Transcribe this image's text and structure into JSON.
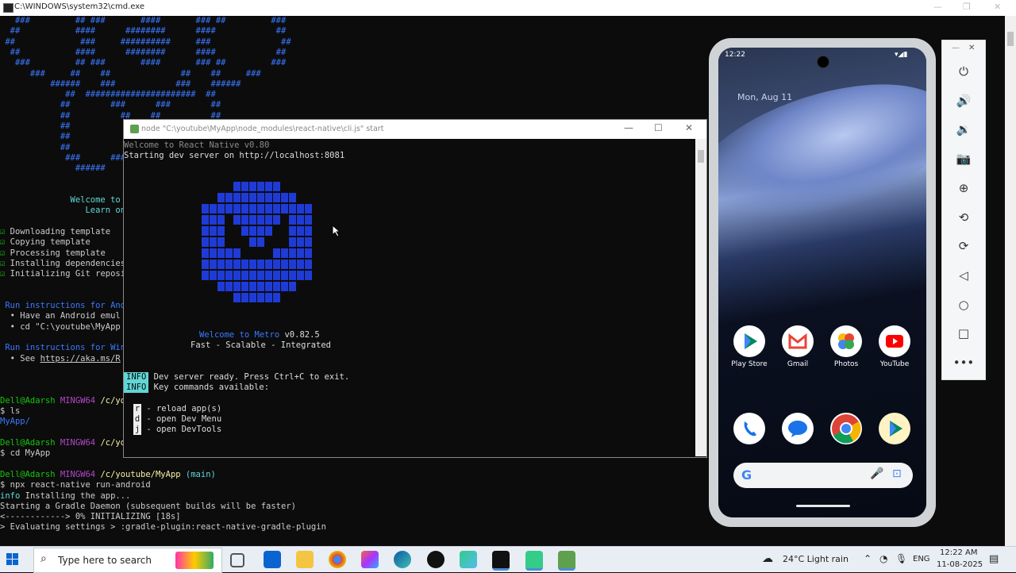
{
  "cmd": {
    "title": "C:\\WINDOWS\\system32\\cmd.exe",
    "ascii_art": [
      "   ###         ## ###       ####       ### ##         ###",
      "  ##           ####      ########      ####            ##",
      " ##             ###     ##########     ###              ##",
      "  ##           ####      ########      ####            ##",
      "   ###         ## ###       ####       ### ##         ###",
      "      ###     ##    ##              ##    ##     ###",
      "          ######    ###            ###    ######",
      "             ##  ######################  ##",
      "            ##        ###      ###        ##",
      "            ##          ##    ##          ##",
      "            ##                            ##",
      "            ##                            ##",
      "            ##                            ##",
      "             ###      ###",
      "               ######"
    ],
    "welcome": [
      "              Welcome to R",
      "                 Learn onc"
    ],
    "steps": [
      "Downloading template",
      "Copying template",
      "Processing template",
      "Installing dependencies",
      "Initializing Git reposit"
    ],
    "run_android": "Run instructions for And",
    "android_bullets": [
      "  • Have an Android emul",
      "  • cd \"C:\\youtube\\MyApp"
    ],
    "run_windows": "Run instructions for Win",
    "windows_bullet_prefix": "  • See ",
    "windows_bullet_link": "https://aka.ms/R",
    "session": [
      {
        "user": "Dell@Adarsh",
        "env": "MINGW64",
        "path": "/c/you"
      },
      {
        "cmd": "$ ls"
      },
      {
        "out": "MyApp/"
      },
      {
        "user": "Dell@Adarsh",
        "env": "MINGW64",
        "path": "/c/you"
      },
      {
        "cmd": "$ cd MyApp"
      },
      {
        "user": "Dell@Adarsh",
        "env": "MINGW64",
        "path": "/c/youtube/MyApp",
        "branch": "(main)"
      },
      {
        "cmd": "$ npx react-native run-android"
      },
      {
        "info_prefix": "info",
        "info_text": " Installing the app..."
      },
      {
        "out": "Starting a Gradle Daemon (subsequent builds will be faster)"
      },
      {
        "out": "<------------> 0% INITIALIZING [18s]"
      },
      {
        "out": "> Evaluating settings > :gradle-plugin:react-native-gradle-plugin"
      }
    ]
  },
  "metro": {
    "title": "node  \"C:\\youtube\\MyApp\\node_modules\\react-native\\cli.js\"  start",
    "welcome_rn": "Welcome to React Native v0.80",
    "starting": "Starting dev server on http://localhost:8081",
    "welcome_metro_label": "Welcome to Metro",
    "metro_version": "v0.82.5",
    "tagline": "Fast - Scalable - Integrated",
    "info_label": "INFO",
    "info_lines": [
      "Dev server ready. Press Ctrl+C to exit.",
      "Key commands available:"
    ],
    "keys": [
      {
        "key": "r",
        "desc": "- reload app(s)"
      },
      {
        "key": "d",
        "desc": "- open Dev Menu"
      },
      {
        "key": "j",
        "desc": "- open DevTools"
      }
    ],
    "logo_color": "#1f3bd6"
  },
  "phone": {
    "time": "12:22",
    "date": "Mon, Aug 11",
    "apps_row1": [
      {
        "label": "Play Store",
        "icon": "play-store-icon"
      },
      {
        "label": "Gmail",
        "icon": "gmail-icon"
      },
      {
        "label": "Photos",
        "icon": "photos-icon"
      },
      {
        "label": "YouTube",
        "icon": "youtube-icon"
      }
    ],
    "dock": [
      {
        "icon": "phone-icon"
      },
      {
        "icon": "messages-icon"
      },
      {
        "icon": "chrome-icon"
      },
      {
        "icon": "play-store-icon"
      }
    ],
    "search_logo": "G"
  },
  "emulator_toolbar": [
    {
      "icon": "power-icon",
      "glyph": "⏻"
    },
    {
      "icon": "volume-up-icon",
      "glyph": "🔊"
    },
    {
      "icon": "volume-down-icon",
      "glyph": "🔉"
    },
    {
      "icon": "camera-icon",
      "glyph": "📷"
    },
    {
      "icon": "zoom-icon",
      "glyph": "⊕"
    },
    {
      "icon": "rotate-left-icon",
      "glyph": "⟲"
    },
    {
      "icon": "rotate-right-icon",
      "glyph": "⟳"
    },
    {
      "icon": "back-icon",
      "glyph": "◁"
    },
    {
      "icon": "home-icon",
      "glyph": "○"
    },
    {
      "icon": "overview-icon",
      "glyph": "□"
    },
    {
      "icon": "more-icon",
      "glyph": "•••"
    }
  ],
  "taskbar": {
    "search_placeholder": "Type here to search",
    "weather": "24°C  Light rain",
    "lang": "ENG",
    "time": "12:22 AM",
    "date": "11-08-2025"
  }
}
